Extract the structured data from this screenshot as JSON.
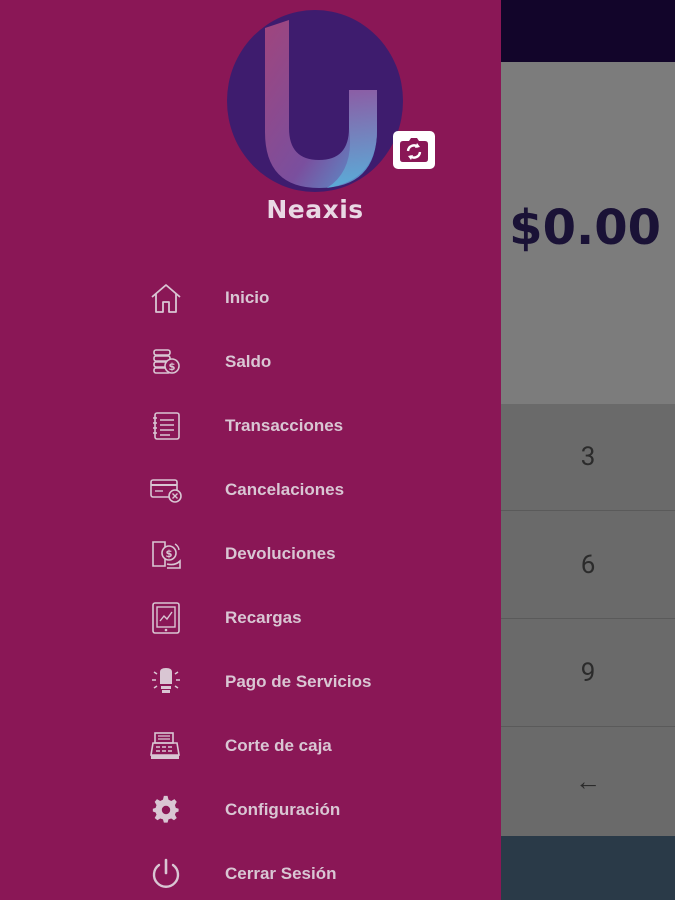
{
  "app": {
    "brand_name": "Neaxis",
    "amount": "$0.00",
    "colors": {
      "drawer_bg": "#8a1756",
      "topbar": "#12052a",
      "logo_bg": "#3e1c6e",
      "text": "#d9c6d3"
    }
  },
  "keypad": {
    "keys": [
      "3",
      "6",
      "9",
      "←"
    ]
  },
  "menu": {
    "items": [
      {
        "label": "Inicio",
        "icon": "home-icon"
      },
      {
        "label": "Saldo",
        "icon": "coins-icon"
      },
      {
        "label": "Transacciones",
        "icon": "list-icon"
      },
      {
        "label": "Cancelaciones",
        "icon": "card-cancel-icon"
      },
      {
        "label": "Devoluciones",
        "icon": "refund-icon"
      },
      {
        "label": "Recargas",
        "icon": "phone-recharge-icon"
      },
      {
        "label": "Pago de Servicios",
        "icon": "lightbulb-icon"
      },
      {
        "label": "Corte de caja",
        "icon": "cash-register-icon"
      },
      {
        "label": "Configuración",
        "icon": "gear-icon"
      },
      {
        "label": "Cerrar Sesión",
        "icon": "power-icon"
      }
    ]
  }
}
